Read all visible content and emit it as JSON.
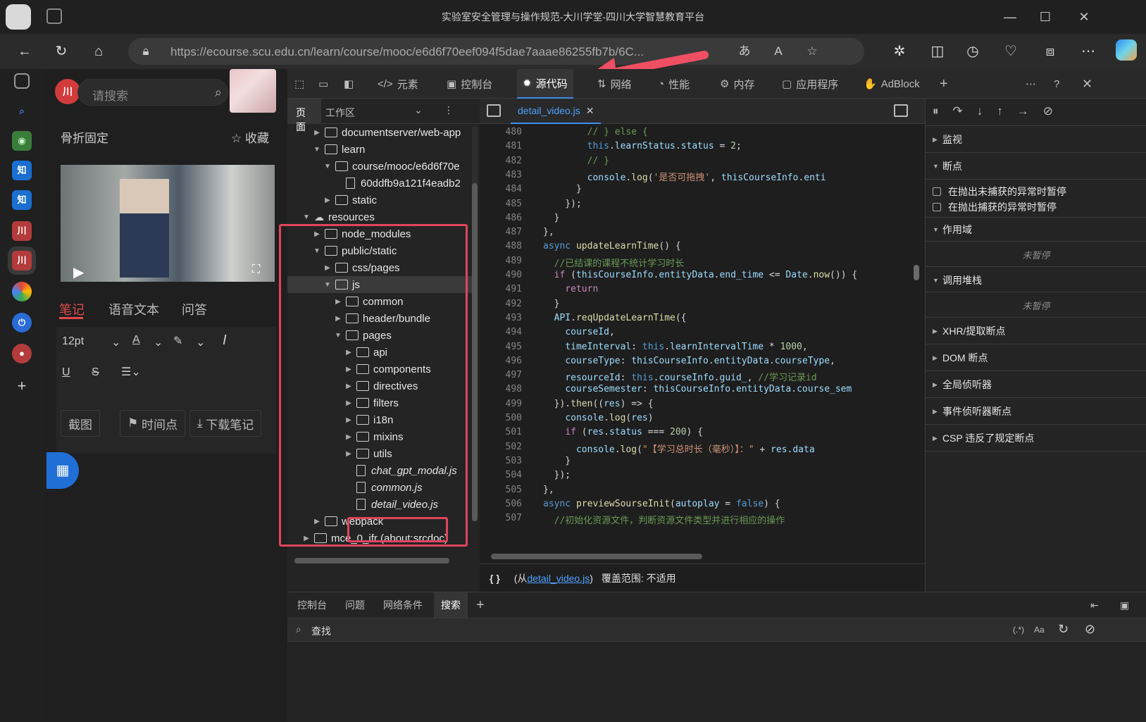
{
  "browser": {
    "title": "实验室安全管理与操作规范-大川学堂-四川大学智慧教育平台",
    "url": "https://ecourse.scu.edu.cn/learn/course/mooc/e6d6f70eef094f5dae7aaae86255fb7b/6C...",
    "colors": {
      "accent": "#3b8eea",
      "highlight": "#e0455c"
    }
  },
  "page": {
    "search_placeholder": "请搜索",
    "course_name": "骨折固定",
    "collect": "☆ 收藏",
    "tabs": [
      "笔记",
      "语音文本",
      "问答"
    ],
    "font_size": "12pt",
    "buttons": {
      "screenshot": "截图",
      "timestamp": "时间点",
      "download": "下载笔记"
    }
  },
  "devtools": {
    "tabs": [
      "元素",
      "控制台",
      "源代码",
      "网络",
      "性能",
      "内存",
      "应用程序",
      "AdBlock"
    ],
    "active_tab": "源代码",
    "tree_tabs": [
      "页面",
      "工作区"
    ],
    "file_tab": "detail_video.js",
    "tree": [
      {
        "label": "documentserver/web-app",
        "type": "folder",
        "depth": 1,
        "arrow": "▶"
      },
      {
        "label": "learn",
        "type": "folder",
        "depth": 1,
        "arrow": "▼"
      },
      {
        "label": "course/mooc/e6d6f70e",
        "type": "folder",
        "depth": 2,
        "arrow": "▼"
      },
      {
        "label": "60ddfb9a121f4eadb2",
        "type": "file",
        "depth": 3,
        "arrow": ""
      },
      {
        "label": "static",
        "type": "folder",
        "depth": 2,
        "arrow": "▶"
      },
      {
        "label": "resources",
        "type": "cloud",
        "depth": 0,
        "arrow": "▼"
      },
      {
        "label": "node_modules",
        "type": "folder",
        "depth": 1,
        "arrow": "▶"
      },
      {
        "label": "public/static",
        "type": "folder",
        "depth": 1,
        "arrow": "▼"
      },
      {
        "label": "css/pages",
        "type": "folder",
        "depth": 2,
        "arrow": "▶"
      },
      {
        "label": "js",
        "type": "folder",
        "depth": 2,
        "arrow": "▼"
      },
      {
        "label": "common",
        "type": "folder",
        "depth": 3,
        "arrow": "▶"
      },
      {
        "label": "header/bundle",
        "type": "folder",
        "depth": 3,
        "arrow": "▶"
      },
      {
        "label": "pages",
        "type": "folder",
        "depth": 3,
        "arrow": "▼"
      },
      {
        "label": "api",
        "type": "folder",
        "depth": 4,
        "arrow": "▶"
      },
      {
        "label": "components",
        "type": "folder",
        "depth": 4,
        "arrow": "▶"
      },
      {
        "label": "directives",
        "type": "folder",
        "depth": 4,
        "arrow": "▶"
      },
      {
        "label": "filters",
        "type": "folder",
        "depth": 4,
        "arrow": "▶"
      },
      {
        "label": "i18n",
        "type": "folder",
        "depth": 4,
        "arrow": "▶"
      },
      {
        "label": "mixins",
        "type": "folder",
        "depth": 4,
        "arrow": "▶"
      },
      {
        "label": "utils",
        "type": "folder",
        "depth": 4,
        "arrow": "▶"
      },
      {
        "label": "chat_gpt_modal.js",
        "type": "file",
        "depth": 4,
        "arrow": ""
      },
      {
        "label": "common.js",
        "type": "file",
        "depth": 4,
        "arrow": ""
      },
      {
        "label": "detail_video.js",
        "type": "file",
        "depth": 4,
        "arrow": ""
      },
      {
        "label": "webpack",
        "type": "folder",
        "depth": 1,
        "arrow": "▶"
      },
      {
        "label": "mce_0_ifr (about:srcdoc)",
        "type": "frame",
        "depth": 0,
        "arrow": "▶"
      }
    ],
    "code_lines": [
      {
        "n": "480",
        "h": "        <span class='c'>// } else {</span>"
      },
      {
        "n": "481",
        "h": "        <span class='k'>this</span>.<span class='pr'>learnStatus</span>.<span class='pr'>status</span> = <span class='n'>2</span>;"
      },
      {
        "n": "482",
        "h": "        <span class='c'>// }</span>"
      },
      {
        "n": "483",
        "h": "        <span class='pr'>console</span>.<span class='fn'>log</span>(<span class='s'>'是否可拖拽'</span>, <span class='pr'>thisCourseInfo</span>.<span class='pr'>enti</span>"
      },
      {
        "n": "484",
        "h": "      }"
      },
      {
        "n": "485",
        "h": "    });"
      },
      {
        "n": "486",
        "h": "  }"
      },
      {
        "n": "487",
        "h": "},"
      },
      {
        "n": "488",
        "h": "<span class='k'>async</span> <span class='fn'>updateLearnTime</span>() {"
      },
      {
        "n": "489",
        "h": "  <span class='c'>//已结课的课程不统计学习时长</span>"
      },
      {
        "n": "490",
        "h": "  <span class='p'>if</span> (<span class='pr'>thisCourseInfo</span>.<span class='pr'>entityData</span>.<span class='pr'>end_time</span> &lt;= <span class='pr'>Date</span>.<span class='fn'>now</span>()) {"
      },
      {
        "n": "491",
        "h": "    <span class='p'>return</span>"
      },
      {
        "n": "492",
        "h": "  }"
      },
      {
        "n": "493",
        "h": "  <span class='pr'>API</span>.<span class='fn'>reqUpdateLearnTime</span>({"
      },
      {
        "n": "494",
        "h": "    <span class='pr'>courseId</span>,"
      },
      {
        "n": "495",
        "h": "    <span class='pr'>timeInterval</span>: <span class='k'>this</span>.<span class='pr'>learnIntervalTime</span> * <span class='n'>1000</span>,"
      },
      {
        "n": "496",
        "h": "    <span class='pr'>courseType</span>: <span class='pr'>thisCourseInfo</span>.<span class='pr'>entityData</span>.<span class='pr'>courseType</span>,"
      },
      {
        "n": "497",
        "h": "    <span class='pr'>resourceId</span>: <span class='k'>this</span>.<span class='pr'>courseInfo</span>.<span class='pr'>guid_</span>, <span class='c'>//学习记录id</span>"
      },
      {
        "n": "498",
        "h": "    <span class='pr'>courseSemester</span>: <span class='pr'>thisCourseInfo</span>.<span class='pr'>entityData</span>.<span class='pr'>course_sem</span>"
      },
      {
        "n": "499",
        "h": "  }).<span class='fn'>then</span>((<span class='pr'>res</span>) =&gt; {"
      },
      {
        "n": "500",
        "h": "    <span class='pr'>console</span>.<span class='fn'>log</span>(<span class='pr'>res</span>)"
      },
      {
        "n": "501",
        "h": "    <span class='p'>if</span> (<span class='pr'>res</span>.<span class='pr'>status</span> === <span class='n'>200</span>) {"
      },
      {
        "n": "502",
        "h": "      <span class='pr'>console</span>.<span class='fn'>log</span>(<span class='s'>\"【学习总时长（毫秒）】：\"</span> + <span class='pr'>res</span>.<span class='pr'>data</span>"
      },
      {
        "n": "503",
        "h": "    }"
      },
      {
        "n": "504",
        "h": "  });"
      },
      {
        "n": "505",
        "h": "},"
      },
      {
        "n": "506",
        "h": "<span class='k'>async</span> <span class='fn'>previewSourseInit</span>(<span class='pr'>autoplay</span> = <span class='k'>false</span>) {"
      },
      {
        "n": "507",
        "h": "  <span class='c'>//初始化资源文件，判断资源文件类型并进行相应的操作</span>"
      }
    ],
    "status_bar": {
      "braces": "{ }",
      "from_prefix": "(从",
      "from_link": "detail_video.js",
      "from_suffix": ")",
      "coverage": "覆盖范围: 不适用"
    },
    "debugger": {
      "watch": "监视",
      "breakpoints": "断点",
      "pause_uncaught": "在抛出未捕获的异常时暂停",
      "pause_caught": "在抛出捕获的异常时暂停",
      "scope": "作用域",
      "not_paused_1": "未暂停",
      "callstack": "调用堆栈",
      "not_paused_2": "未暂停",
      "xhr": "XHR/提取断点",
      "dom": "DOM 断点",
      "global": "全局侦听器",
      "event": "事件侦听器断点",
      "csp": "CSP 违反了规定断点"
    },
    "drawer_tabs": [
      "控制台",
      "问题",
      "网络条件",
      "搜索"
    ],
    "drawer_active": "搜索",
    "find_placeholder": "查找",
    "find_opts": {
      "regex": "(.*)",
      "case": "Aa"
    }
  }
}
